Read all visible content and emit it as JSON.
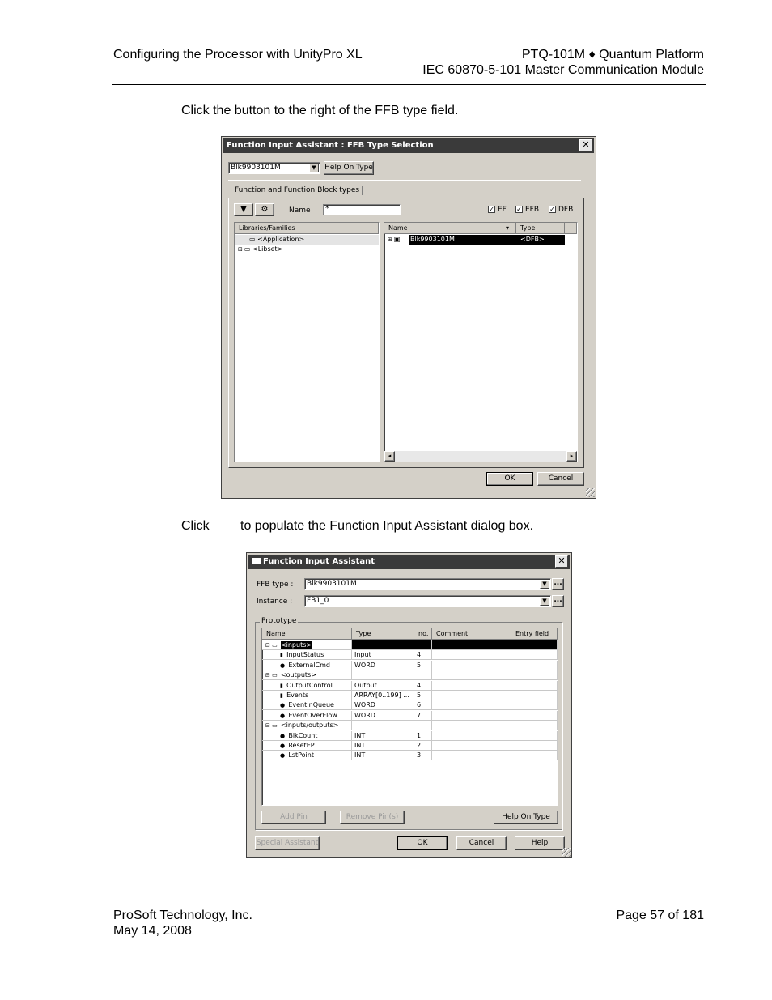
{
  "header": {
    "left": "Configuring the Processor with UnityPro XL",
    "right_line1": "PTQ-101M ♦ Quantum Platform",
    "right_line2": "IEC 60870-5-101 Master Communication Module"
  },
  "para1": "Click the button to the right of the FFB type field.",
  "para2_a": "Click",
  "para2_b": "to populate the Function Input Assistant dialog box.",
  "dialog1": {
    "title": "Function Input Assistant : FFB Type Selection",
    "close": "✕",
    "combo_value": "Blk9903101M",
    "help_button": "Help On Type",
    "tab_label": "Function and Function Block types",
    "filter_label": "Name",
    "filter_value": "*",
    "checks": [
      {
        "label": "EF",
        "checked": "✓"
      },
      {
        "label": "EFB",
        "checked": "✓"
      },
      {
        "label": "DFB",
        "checked": "✓"
      }
    ],
    "left_header": "Libraries/Families",
    "left_items": [
      "<Application>",
      "<Libset>"
    ],
    "right_headers": [
      "Name",
      "Type"
    ],
    "right_row": {
      "name": "Blk9903101M",
      "type": "<DFB>"
    },
    "ok": "OK",
    "cancel": "Cancel"
  },
  "dialog2": {
    "title": "Function Input Assistant",
    "close": "✕",
    "ffb_label": "FFB type :",
    "ffb_value": "Blk9903101M",
    "instance_label": "Instance :",
    "instance_value": "FB1_0",
    "prototype_label": "Prototype",
    "headers": [
      "Name",
      "Type",
      "no.",
      "Comment",
      "Entry field"
    ],
    "rows": [
      {
        "name": "<inputs>",
        "type": "",
        "no": "",
        "level": 0,
        "kind": "group",
        "selected": true
      },
      {
        "name": "InputStatus",
        "type": "Input",
        "no": "4",
        "level": 1,
        "kind": "var"
      },
      {
        "name": "ExternalCmd",
        "type": "WORD",
        "no": "5",
        "level": 1,
        "kind": "elem"
      },
      {
        "name": "<outputs>",
        "type": "",
        "no": "",
        "level": 0,
        "kind": "group"
      },
      {
        "name": "OutputControl",
        "type": "Output",
        "no": "4",
        "level": 1,
        "kind": "var"
      },
      {
        "name": "Events",
        "type": "ARRAY[0..199] ...",
        "no": "5",
        "level": 1,
        "kind": "var"
      },
      {
        "name": "EventInQueue",
        "type": "WORD",
        "no": "6",
        "level": 1,
        "kind": "elem"
      },
      {
        "name": "EventOverFlow",
        "type": "WORD",
        "no": "7",
        "level": 1,
        "kind": "elem"
      },
      {
        "name": "<inputs/outputs>",
        "type": "",
        "no": "",
        "level": 0,
        "kind": "group"
      },
      {
        "name": "BlkCount",
        "type": "INT",
        "no": "1",
        "level": 1,
        "kind": "elem"
      },
      {
        "name": "ResetEP",
        "type": "INT",
        "no": "2",
        "level": 1,
        "kind": "elem"
      },
      {
        "name": "LstPoint",
        "type": "INT",
        "no": "3",
        "level": 1,
        "kind": "elem"
      }
    ],
    "add_pin": "Add Pin",
    "remove_pin": "Remove Pin(s)",
    "help_on_type": "Help On Type",
    "special": "Special Assistant",
    "ok": "OK",
    "cancel": "Cancel",
    "help": "Help"
  },
  "footer": {
    "company": "ProSoft Technology, Inc.",
    "date": "May 14, 2008",
    "page": "Page 57 of 181"
  }
}
